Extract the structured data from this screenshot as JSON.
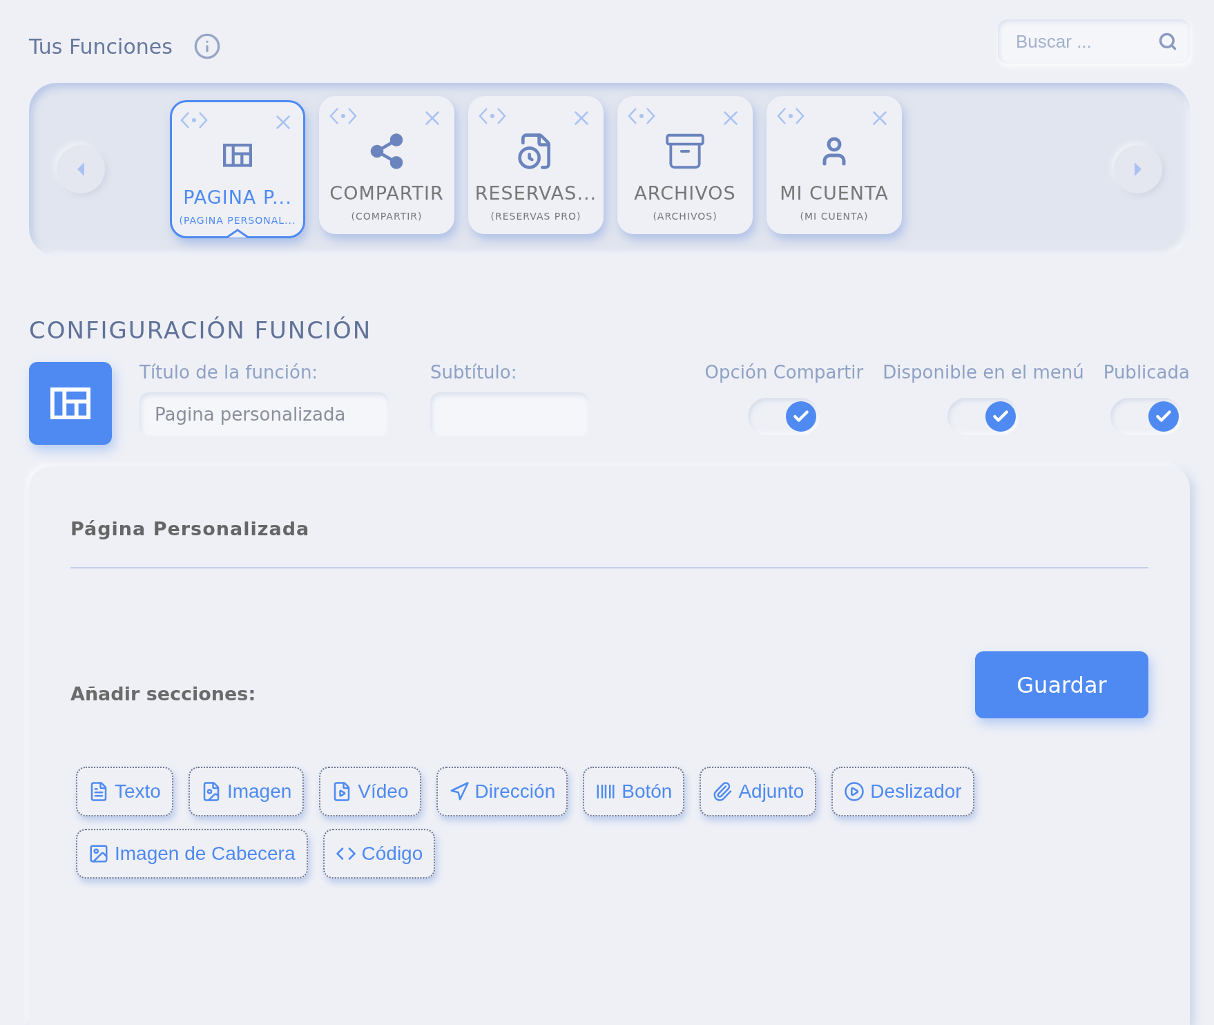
{
  "header": {
    "title": "Tus Funciones",
    "search": {
      "placeholder": "Buscar ..."
    }
  },
  "functions": [
    {
      "kind": "layout",
      "title": "PAGINA P...",
      "subtitle": "(PAGINA PERSONAL...",
      "selected": true
    },
    {
      "kind": "share",
      "title": "COMPARTIR",
      "subtitle": "(COMPARTIR)",
      "selected": false
    },
    {
      "kind": "reservations",
      "title": "RESERVAS...",
      "subtitle": "(RESERVAS PRO)",
      "selected": false
    },
    {
      "kind": "archive",
      "title": "ARCHIVOS",
      "subtitle": "(ARCHIVOS)",
      "selected": false
    },
    {
      "kind": "account",
      "title": "MI CUENTA",
      "subtitle": "(MI CUENTA)",
      "selected": false
    }
  ],
  "config": {
    "heading": "CONFIGURACIÓN FUNCIÓN",
    "fields": [
      {
        "label": "Título de la función:",
        "value": "Pagina personalizada"
      },
      {
        "label": "Subtítulo:"
      }
    ],
    "toggles": [
      {
        "label": "Opción Compartir",
        "on": true
      },
      {
        "label": "Disponible en el menú",
        "on": true
      },
      {
        "label": "Publicada",
        "on": true
      }
    ]
  },
  "editor": {
    "title": "Página Personalizada",
    "sections_label": "Añadir secciones:",
    "save_button": "Guardar",
    "sections": [
      {
        "kind": "text",
        "label": "Texto"
      },
      {
        "kind": "image",
        "label": "Imagen"
      },
      {
        "kind": "video",
        "label": "Vídeo"
      },
      {
        "kind": "address",
        "label": "Dirección"
      },
      {
        "kind": "button",
        "label": "Botón"
      },
      {
        "kind": "attachment",
        "label": "Adjunto"
      },
      {
        "kind": "slider",
        "label": "Deslizador"
      },
      {
        "kind": "header_image",
        "label": "Imagen de Cabecera"
      },
      {
        "kind": "code",
        "label": "Código"
      }
    ]
  }
}
